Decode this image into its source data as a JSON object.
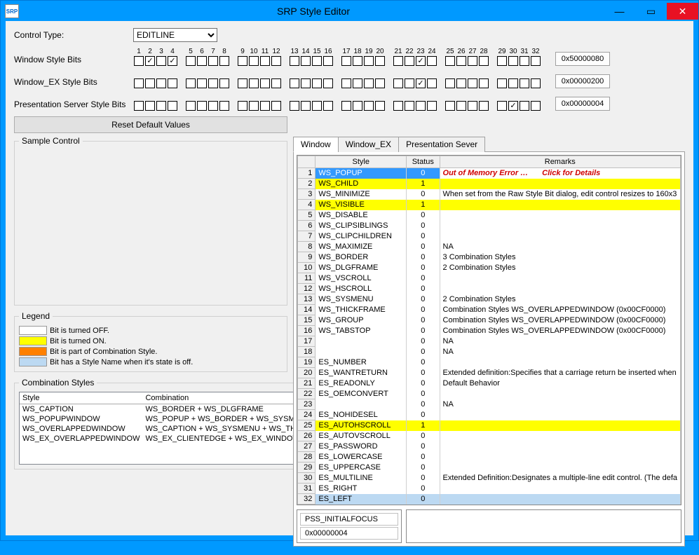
{
  "window": {
    "title": "SRP Style Editor",
    "icon_text": "SRP"
  },
  "controls": {
    "control_type_label": "Control Type:",
    "control_type_value": "EDITLINE",
    "reset_button": "Reset Default Values"
  },
  "bit_rows": [
    {
      "label": "Window Style Bits",
      "checked": [
        2,
        4,
        23
      ],
      "hex": "0x50000080"
    },
    {
      "label": "Window_EX Style Bits",
      "checked": [
        23
      ],
      "hex": "0x00000200"
    },
    {
      "label": "Presentation Server Style Bits",
      "checked": [
        30
      ],
      "hex": "0x00000004"
    }
  ],
  "bit_groups": [
    [
      1,
      2,
      3,
      4
    ],
    [
      5,
      6,
      7,
      8
    ],
    [
      9,
      10,
      11,
      12
    ],
    [
      13,
      14,
      15,
      16
    ],
    [
      17,
      18,
      19,
      20
    ],
    [
      21,
      22,
      23,
      24
    ],
    [
      25,
      26,
      27,
      28
    ],
    [
      29,
      30,
      31,
      32
    ]
  ],
  "fieldsets": {
    "sample": "Sample Control",
    "legend": "Legend",
    "combination": "Combination Styles"
  },
  "legend_items": [
    {
      "color": "#ffffff",
      "text": "Bit is turned OFF."
    },
    {
      "color": "#ffff00",
      "text": "Bit is turned ON."
    },
    {
      "color": "#ff8000",
      "text": "Bit is part of Combination Style."
    },
    {
      "color": "#bcd9f2",
      "text": "Bit has a Style Name when it's state is off."
    }
  ],
  "combination_headers": {
    "style": "Style",
    "combination": "Combination"
  },
  "combination_rows": [
    {
      "style": "WS_CAPTION",
      "combo": "WS_BORDER + WS_DLGFRAME"
    },
    {
      "style": "WS_POPUPWINDOW",
      "combo": "WS_POPUP + WS_BORDER + WS_SYSMENU"
    },
    {
      "style": "WS_OVERLAPPEDWINDOW",
      "combo": "WS_CAPTION + WS_SYSMENU + WS_THICKFRAME"
    },
    {
      "style": "WS_EX_OVERLAPPEDWINDOW",
      "combo": "WS_EX_CLIENTEDGE + WS_EX_WINDOWEDGE"
    }
  ],
  "tabs": [
    {
      "label": "Window",
      "active": true
    },
    {
      "label": "Window_EX",
      "active": false
    },
    {
      "label": "Presentation Sever",
      "active": false
    }
  ],
  "grid_headers": {
    "style": "Style",
    "status": "Status",
    "remarks": "Remarks"
  },
  "grid_rows": [
    {
      "n": 1,
      "style": "WS_POPUP",
      "status": 0,
      "remarks_err": "Out of Memory Error …",
      "remarks_err2": "Click for Details",
      "klass": "row-blue"
    },
    {
      "n": 2,
      "style": "WS_CHILD",
      "status": 1,
      "remarks": "",
      "klass": "row-yellow"
    },
    {
      "n": 3,
      "style": "WS_MINIMIZE",
      "status": 0,
      "remarks": "When set from the Raw Style Bit dialog, edit control resizes to 160x3"
    },
    {
      "n": 4,
      "style": "WS_VISIBLE",
      "status": 1,
      "remarks": "",
      "klass": "row-yellow"
    },
    {
      "n": 5,
      "style": "WS_DISABLE",
      "status": 0,
      "remarks": ""
    },
    {
      "n": 6,
      "style": "WS_CLIPSIBLINGS",
      "status": 0,
      "remarks": ""
    },
    {
      "n": 7,
      "style": "WS_CLIPCHILDREN",
      "status": 0,
      "remarks": ""
    },
    {
      "n": 8,
      "style": "WS_MAXIMIZE",
      "status": 0,
      "remarks": "NA"
    },
    {
      "n": 9,
      "style": "WS_BORDER",
      "status": 0,
      "remarks": "3 Combination Styles"
    },
    {
      "n": 10,
      "style": "WS_DLGFRAME",
      "status": 0,
      "remarks": "2 Combination Styles"
    },
    {
      "n": 11,
      "style": "WS_VSCROLL",
      "status": 0,
      "remarks": ""
    },
    {
      "n": 12,
      "style": "WS_HSCROLL",
      "status": 0,
      "remarks": ""
    },
    {
      "n": 13,
      "style": "WS_SYSMENU",
      "status": 0,
      "remarks": "2 Combination Styles"
    },
    {
      "n": 14,
      "style": "WS_THICKFRAME",
      "status": 0,
      "remarks": "Combination Styles WS_OVERLAPPEDWINDOW (0x00CF0000)"
    },
    {
      "n": 15,
      "style": "WS_GROUP",
      "status": 0,
      "remarks": "Combination Styles WS_OVERLAPPEDWINDOW (0x00CF0000)"
    },
    {
      "n": 16,
      "style": "WS_TABSTOP",
      "status": 0,
      "remarks": "Combination Styles WS_OVERLAPPEDWINDOW (0x00CF0000)"
    },
    {
      "n": 17,
      "style": "",
      "status": 0,
      "remarks": "NA"
    },
    {
      "n": 18,
      "style": "",
      "status": 0,
      "remarks": "NA"
    },
    {
      "n": 19,
      "style": "ES_NUMBER",
      "status": 0,
      "remarks": ""
    },
    {
      "n": 20,
      "style": "ES_WANTRETURN",
      "status": 0,
      "remarks": "Extended definition:Specifies that a carriage return be inserted when"
    },
    {
      "n": 21,
      "style": "ES_READONLY",
      "status": 0,
      "remarks": "Default Behavior"
    },
    {
      "n": 22,
      "style": "ES_OEMCONVERT",
      "status": 0,
      "remarks": ""
    },
    {
      "n": 23,
      "style": "",
      "status": 0,
      "remarks": "NA"
    },
    {
      "n": 24,
      "style": "ES_NOHIDESEL",
      "status": 0,
      "remarks": ""
    },
    {
      "n": 25,
      "style": "ES_AUTOHSCROLL",
      "status": 1,
      "remarks": "",
      "klass": "row-yellow"
    },
    {
      "n": 26,
      "style": "ES_AUTOVSCROLL",
      "status": 0,
      "remarks": ""
    },
    {
      "n": 27,
      "style": "ES_PASSWORD",
      "status": 0,
      "remarks": ""
    },
    {
      "n": 28,
      "style": "ES_LOWERCASE",
      "status": 0,
      "remarks": ""
    },
    {
      "n": 29,
      "style": "ES_UPPERCASE",
      "status": 0,
      "remarks": ""
    },
    {
      "n": 30,
      "style": "ES_MULTILINE",
      "status": 0,
      "remarks": "Extended Definition:Designates a multiple-line edit control. (The defa"
    },
    {
      "n": 31,
      "style": "ES_RIGHT",
      "status": 0,
      "remarks": ""
    },
    {
      "n": 32,
      "style": "ES_LEFT",
      "status": 0,
      "remarks": "",
      "klass": "row-lightblue"
    }
  ],
  "bottom": {
    "name": "PSS_INITIALFOCUS",
    "hex": "0x00000004"
  }
}
